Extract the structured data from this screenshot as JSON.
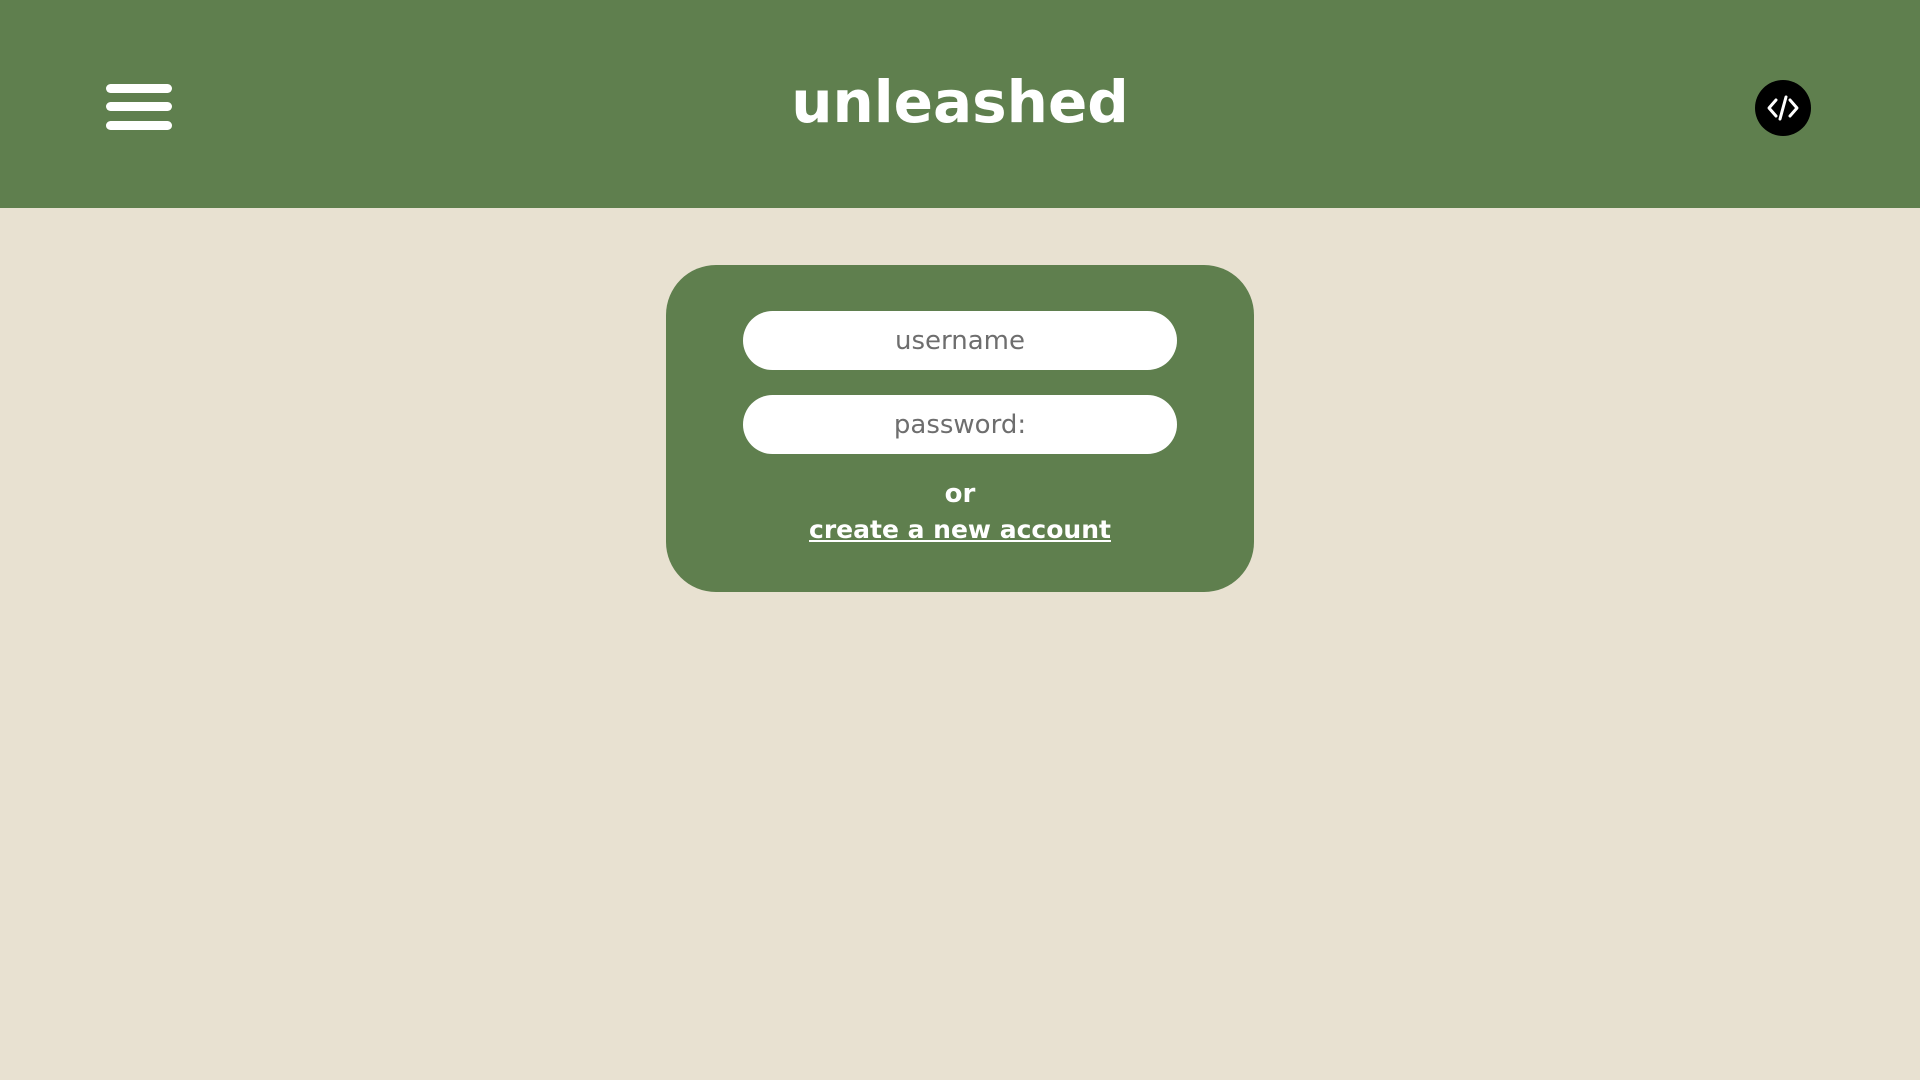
{
  "header": {
    "title": "unleashed",
    "menu_icon": "hamburger-menu-icon",
    "code_icon": "code-brackets-icon"
  },
  "login": {
    "username_placeholder": "username",
    "password_placeholder": "password:",
    "or_text": "or",
    "create_account_label": "create a new account"
  },
  "colors": {
    "header_bg": "#5f7f4e",
    "page_bg": "#e8e1d1",
    "card_bg": "#5f7f4e",
    "text": "#ffffff"
  }
}
